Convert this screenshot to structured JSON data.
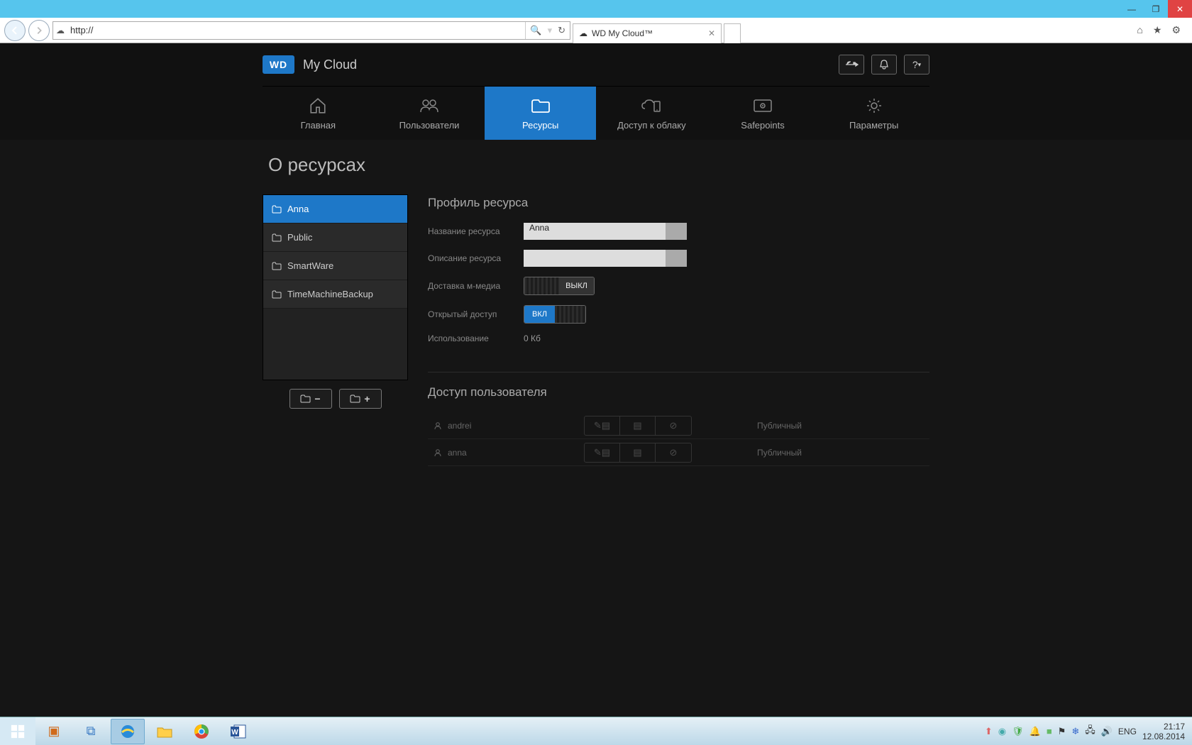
{
  "window": {
    "tab_title": "WD My Cloud™",
    "addr": "http://"
  },
  "brand": "My Cloud",
  "wd_logo": "WD",
  "nav": [
    {
      "id": "home",
      "label": "Главная"
    },
    {
      "id": "users",
      "label": "Пользователи"
    },
    {
      "id": "shares",
      "label": "Ресурсы"
    },
    {
      "id": "cloud",
      "label": "Доступ к облаку"
    },
    {
      "id": "safepoints",
      "label": "Safepoints"
    },
    {
      "id": "settings",
      "label": "Параметры"
    }
  ],
  "page_title": "О ресурсах",
  "shares": [
    {
      "name": "Anna",
      "selected": true
    },
    {
      "name": "Public"
    },
    {
      "name": "SmartWare"
    },
    {
      "name": "TimeMachineBackup"
    }
  ],
  "profile": {
    "section_title": "Профиль ресурса",
    "name_label": "Название ресурса",
    "name_value": "Anna",
    "desc_label": "Описание ресурса",
    "desc_value": "",
    "media_label": "Доставка м-медиа",
    "media_state": "off",
    "media_off_text": "ВЫКЛ",
    "public_label": "Открытый доступ",
    "public_state": "on",
    "public_on_text": "ВКЛ",
    "usage_label": "Использование",
    "usage_value": "0 Кб"
  },
  "access": {
    "section_title": "Доступ пользователя",
    "public_label": "Публичный",
    "users": [
      {
        "name": "andrei"
      },
      {
        "name": "anna"
      }
    ]
  },
  "taskbar": {
    "lang": "ENG",
    "time": "21:17",
    "date": "12.08.2014"
  }
}
